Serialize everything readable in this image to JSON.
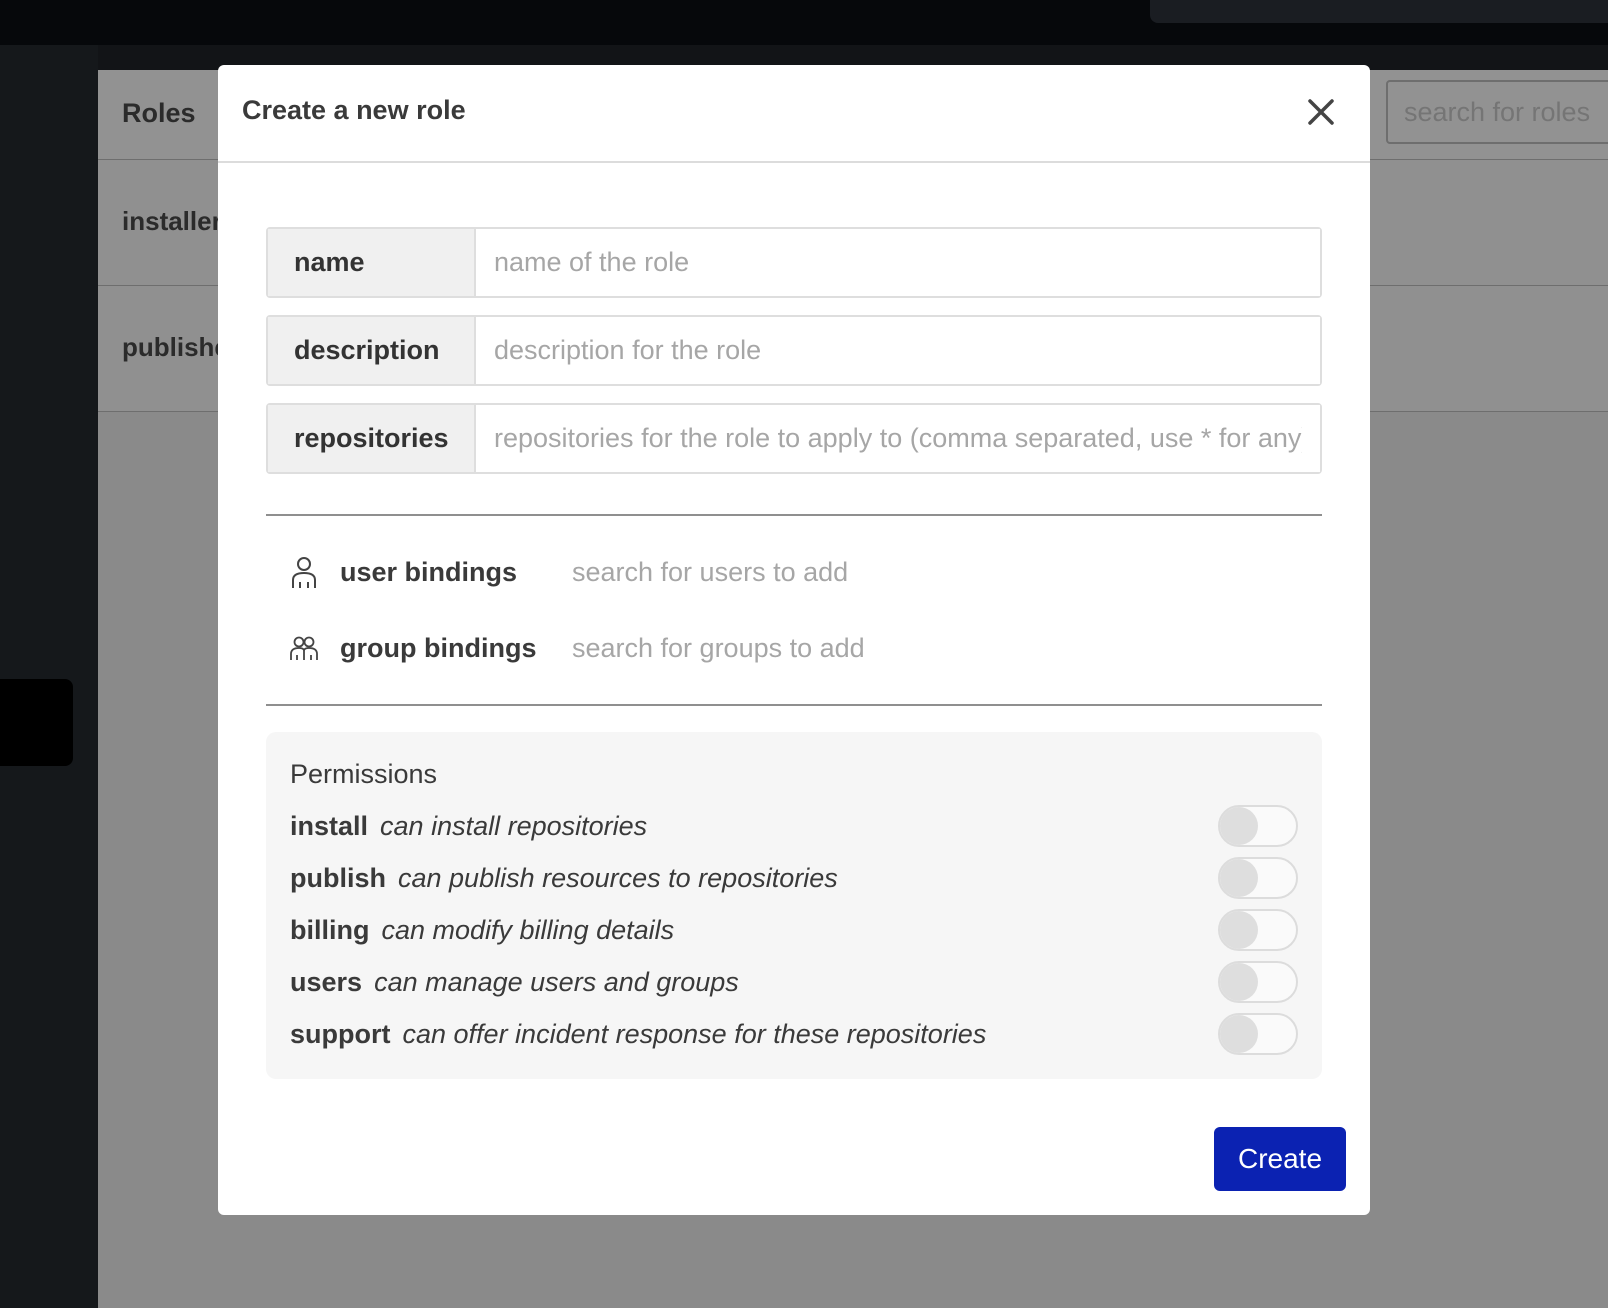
{
  "background": {
    "panel_title": "Roles",
    "search_placeholder": "search for roles",
    "roles": [
      {
        "name": "installer"
      },
      {
        "name": "publisher"
      }
    ]
  },
  "modal": {
    "title": "Create a new role",
    "close_icon": "close-icon",
    "fields": {
      "name": {
        "label": "name",
        "placeholder": "name of the role",
        "value": ""
      },
      "description": {
        "label": "description",
        "placeholder": "description for the role",
        "value": ""
      },
      "repositories": {
        "label": "repositories",
        "placeholder": "repositories for the role to apply to (comma separated, use * for any)",
        "value": ""
      }
    },
    "bindings": {
      "user": {
        "icon": "user-icon",
        "label": "user bindings",
        "placeholder": "search for users to add"
      },
      "group": {
        "icon": "group-icon",
        "label": "group bindings",
        "placeholder": "search for groups to add"
      }
    },
    "permissions": {
      "title": "Permissions",
      "items": [
        {
          "name": "install",
          "description": "can install repositories",
          "enabled": false
        },
        {
          "name": "publish",
          "description": "can publish resources to repositories",
          "enabled": false
        },
        {
          "name": "billing",
          "description": "can modify billing details",
          "enabled": false
        },
        {
          "name": "users",
          "description": "can manage users and groups",
          "enabled": false
        },
        {
          "name": "support",
          "description": "can offer incident response for these repositories",
          "enabled": false
        }
      ]
    },
    "create_label": "Create",
    "colors": {
      "primary": "#0b22b2",
      "overlay": "#8a8a8a"
    }
  }
}
